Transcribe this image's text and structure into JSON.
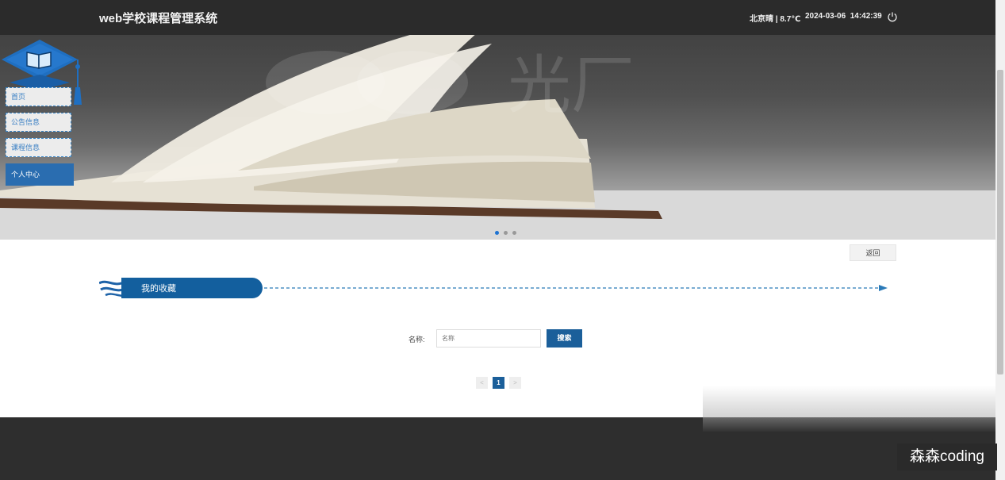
{
  "header": {
    "title": "web学校课程管理系统",
    "weather": "北京晴 | 8.7℃",
    "date": "2024-03-06",
    "time": "14:42:39"
  },
  "banner": {
    "watermark_text": "光厂",
    "slides": 3,
    "active_slide": 1
  },
  "nav": {
    "items": [
      {
        "label": "首页"
      },
      {
        "label": "公告信息"
      },
      {
        "label": "课程信息"
      },
      {
        "label": "个人中心"
      }
    ]
  },
  "actions": {
    "back_label": "返回"
  },
  "section": {
    "title": "我的收藏"
  },
  "search": {
    "label": "名称:",
    "placeholder": "名称",
    "button_label": "搜索"
  },
  "pagination": {
    "prev": "<",
    "current": "1",
    "next": ">"
  },
  "overlay": {
    "watermark": "森森coding"
  },
  "colors": {
    "accent": "#1b5f9a",
    "nav_active": "#2a6db0",
    "header_bg": "#2b2b2b"
  }
}
